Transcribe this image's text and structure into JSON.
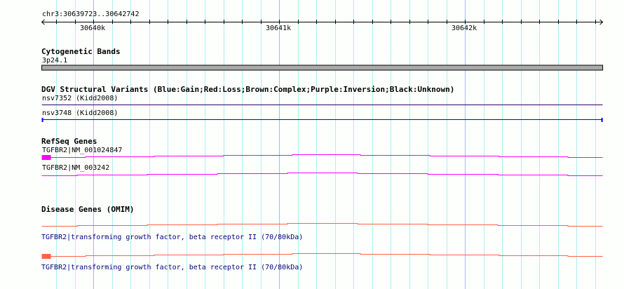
{
  "ruler": {
    "region": "chr3:30639723..30642742",
    "start": 30639723,
    "end": 30642742,
    "major_ticks": [
      {
        "pos": 30640000,
        "label": "30640k"
      },
      {
        "pos": 30641000,
        "label": "30641k"
      },
      {
        "pos": 30642000,
        "label": "30642k"
      }
    ]
  },
  "tracks": {
    "cyto": {
      "title": "Cytogenetic Bands",
      "band": "3p24.1"
    },
    "dgv": {
      "title": "DGV Structural Variants (Blue:Gain;Red:Loss;Brown:Complex;Purple:Inversion;Black:Unknown)",
      "items": [
        {
          "label": "nsv7352 (Kidd2008)",
          "color": "#330066"
        },
        {
          "label": "nsv3748 (Kidd2008)",
          "color": "#0000ff"
        }
      ]
    },
    "refseq": {
      "title": "RefSeq Genes",
      "color": "#ff00ff",
      "items": [
        {
          "label": "TGFBR2|NM_001024847"
        },
        {
          "label": "TGFBR2|NM_003242"
        }
      ]
    },
    "omim": {
      "title": "Disease Genes (OMIM)",
      "color": "#ff6347",
      "items": [
        {
          "label": "TGFBR2|transforming growth factor, beta receptor II (70/80kDa)"
        },
        {
          "label": "TGFBR2|transforming growth factor, beta receptor II (70/80kDa)"
        }
      ]
    }
  },
  "colors": {
    "grid_minor": "#aeeef0",
    "grid_major": "#8cc8e0",
    "band": "#aaaaaa"
  }
}
